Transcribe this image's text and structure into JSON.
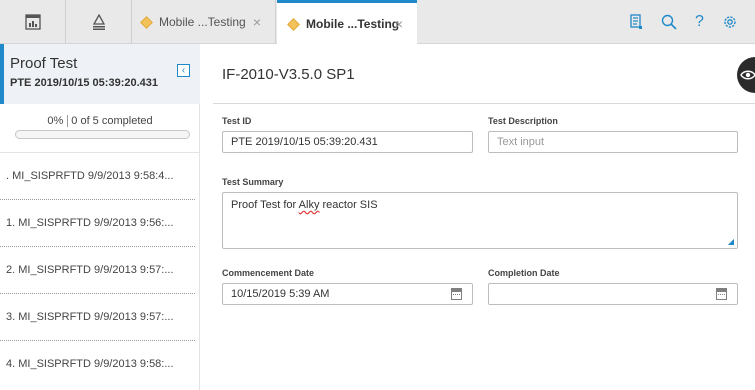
{
  "colors": {
    "accent": "#1f89c9",
    "tab_icon": "#f3c25b"
  },
  "toolbar": {
    "icons": [
      "dashboard-icon",
      "hierarchy-icon",
      "documents-icon",
      "search-icon",
      "help-icon",
      "settings-icon"
    ],
    "help_glyph": "?"
  },
  "tabs": [
    {
      "label": "Mobile ...Testing",
      "close": "×",
      "active": false
    },
    {
      "label": "Mobile ...Testing",
      "close": "×",
      "active": true
    }
  ],
  "sidebar": {
    "title": "Proof Test",
    "subtitle": "PTE 2019/10/15 05:39:20.431",
    "collapse_glyph": "‹",
    "progress": {
      "percent_label": "0%",
      "count_label": "0 of 5 completed",
      "fraction": 0
    },
    "items": [
      ". MI_SISPRFTD 9/9/2013 9:58:4...",
      "1. MI_SISPRFTD 9/9/2013 9:56:...",
      "2. MI_SISPRFTD 9/9/2013 9:57:...",
      "3. MI_SISPRFTD 9/9/2013 9:57:...",
      "4. MI_SISPRFTD 9/9/2013 9:58:..."
    ]
  },
  "main": {
    "title": "IF-2010-V3.5.0 SP1",
    "fields": {
      "test_id": {
        "label": "Test ID",
        "value": "PTE 2019/10/15 05:39:20.431"
      },
      "test_description": {
        "label": "Test Description",
        "placeholder": "Text input"
      },
      "test_summary": {
        "label": "Test Summary",
        "value_prefix": "Proof Test for ",
        "value_misspelled": "Alky",
        "value_suffix": " reactor SIS"
      },
      "commencement_date": {
        "label": "Commencement Date",
        "value": "10/15/2019 5:39 AM"
      },
      "completion_date": {
        "label": "Completion Date",
        "value": ""
      }
    }
  }
}
